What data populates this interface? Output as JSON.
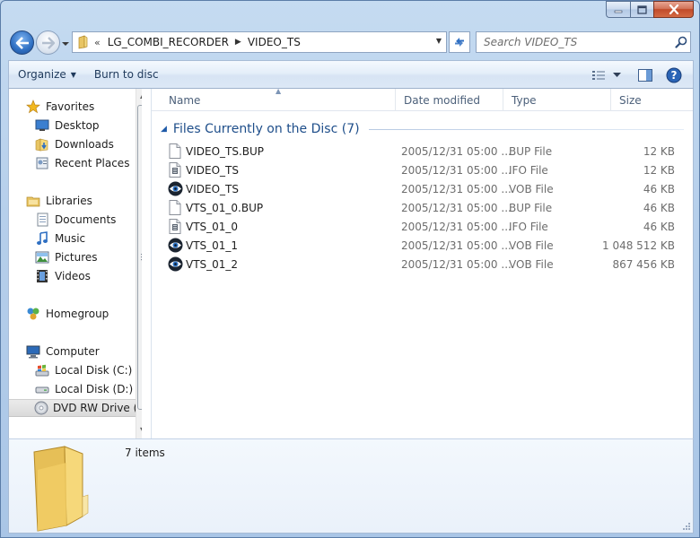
{
  "address": {
    "overflow": "«",
    "crumbs": [
      "LG_COMBI_RECORDER",
      "VIDEO_TS"
    ]
  },
  "search": {
    "placeholder": "Search VIDEO_TS"
  },
  "commandbar": {
    "organize": "Organize",
    "burn": "Burn to disc"
  },
  "nav": {
    "favorites": "Favorites",
    "desktop": "Desktop",
    "downloads": "Downloads",
    "recent": "Recent Places",
    "libraries": "Libraries",
    "documents": "Documents",
    "music": "Music",
    "pictures": "Pictures",
    "videos": "Videos",
    "homegroup": "Homegroup",
    "computer": "Computer",
    "local_c": "Local Disk (C:)",
    "local_d": "Local Disk (D:)",
    "dvd": "DVD RW Drive (E:"
  },
  "columns": {
    "name": "Name",
    "date": "Date modified",
    "type": "Type",
    "size": "Size"
  },
  "group": {
    "title": "Files Currently on the Disc (7)"
  },
  "files": [
    {
      "name": "VIDEO_TS.BUP",
      "date": "2005/12/31 05:00 ...",
      "type": "BUP File",
      "size": "12 KB",
      "icon": "blank-file-icon"
    },
    {
      "name": "VIDEO_TS",
      "date": "2005/12/31 05:00 ...",
      "type": "IFO File",
      "size": "12 KB",
      "icon": "ifo-file-icon"
    },
    {
      "name": "VIDEO_TS",
      "date": "2005/12/31 05:00 ...",
      "type": "VOB File",
      "size": "46 KB",
      "icon": "vob-eye-icon"
    },
    {
      "name": "VTS_01_0.BUP",
      "date": "2005/12/31 05:00 ...",
      "type": "BUP File",
      "size": "46 KB",
      "icon": "blank-file-icon"
    },
    {
      "name": "VTS_01_0",
      "date": "2005/12/31 05:00 ...",
      "type": "IFO File",
      "size": "46 KB",
      "icon": "ifo-file-icon"
    },
    {
      "name": "VTS_01_1",
      "date": "2005/12/31 05:00 ...",
      "type": "VOB File",
      "size": "1 048 512 KB",
      "icon": "vob-eye-icon"
    },
    {
      "name": "VTS_01_2",
      "date": "2005/12/31 05:00 ...",
      "type": "VOB File",
      "size": "867 456 KB",
      "icon": "vob-eye-icon"
    }
  ],
  "details": {
    "count": "7 items"
  },
  "colors": {
    "accent": "#1e4e8a",
    "close": "#c04a2a",
    "frame": "#b6cfeb"
  }
}
